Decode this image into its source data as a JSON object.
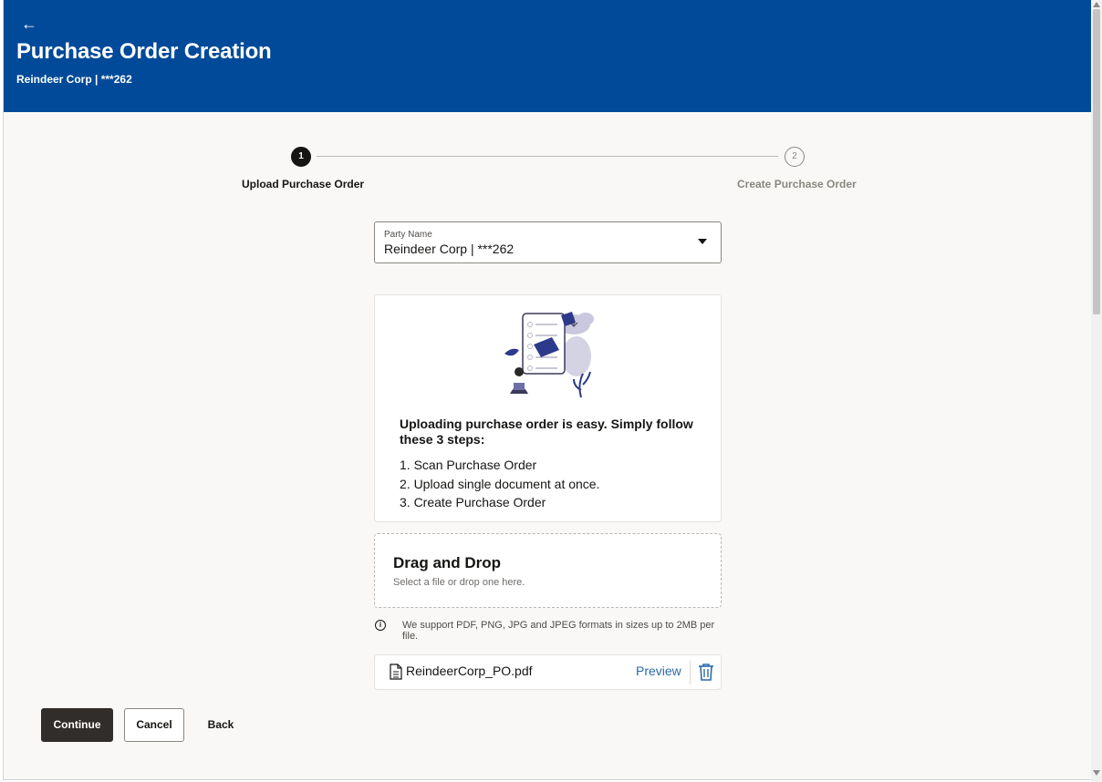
{
  "header": {
    "back_icon": "arrow-left-icon",
    "title": "Purchase Order Creation",
    "subtitle": "Reindeer Corp | ***262",
    "bg_color": "#004a99"
  },
  "stepper": {
    "steps": [
      {
        "number": "1",
        "label": "Upload Purchase Order",
        "state": "active"
      },
      {
        "number": "2",
        "label": "Create Purchase Order",
        "state": "inactive"
      }
    ]
  },
  "party_select": {
    "label": "Party Name",
    "value": "Reindeer Corp | ***262"
  },
  "info_card": {
    "heading": "Uploading purchase order is easy. Simply follow these 3 steps:",
    "steps": [
      "1. Scan Purchase Order",
      "2. Upload single document at once.",
      "3. Create Purchase Order"
    ]
  },
  "drop_zone": {
    "title": "Drag and Drop",
    "subtitle": "Select a file or drop one here."
  },
  "support_note": "We support PDF, PNG, JPG and JPEG formats in sizes up to 2MB per file.",
  "uploaded_file": {
    "name": "ReindeerCorp_PO.pdf",
    "preview_label": "Preview"
  },
  "footer": {
    "continue_label": "Continue",
    "cancel_label": "Cancel",
    "back_label": "Back"
  }
}
